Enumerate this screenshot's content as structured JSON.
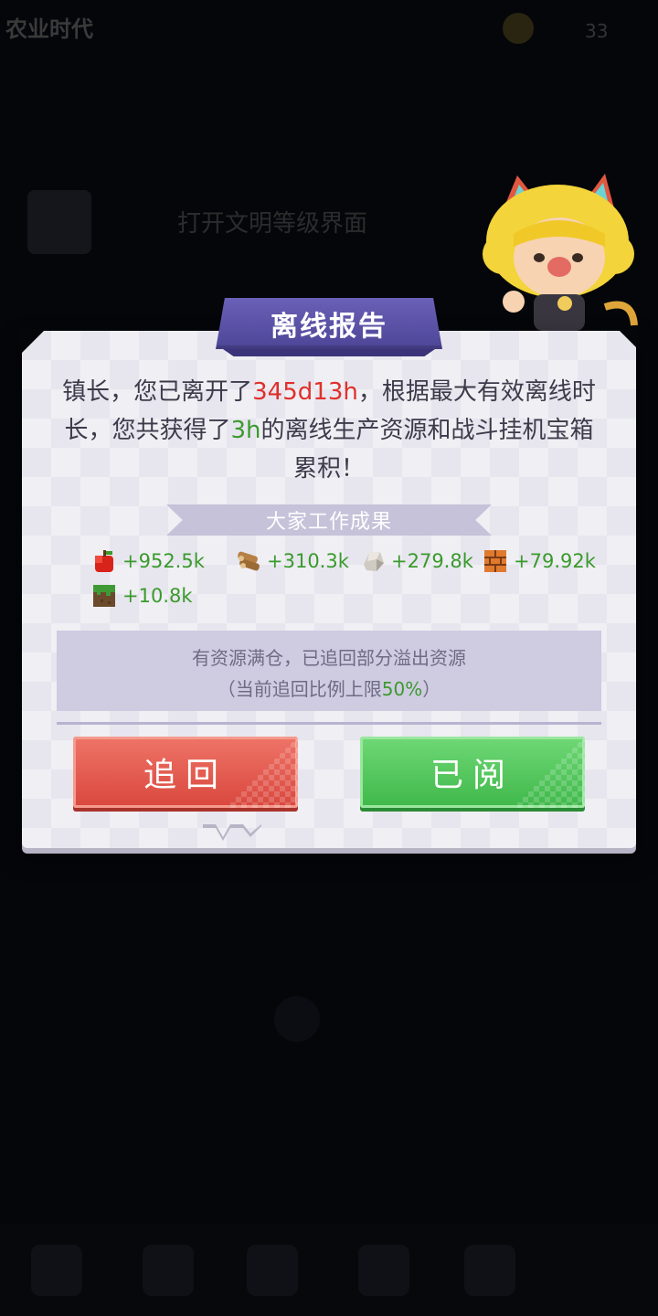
{
  "background": {
    "era_title": "农业时代",
    "coin_value": "33",
    "civ_prompt": "打开文明等级界面"
  },
  "dialog": {
    "title": "离线报告",
    "message": {
      "p1": "镇长，您已离开了",
      "offline_time": "345d13h",
      "p2": "，根据最大有效离线时长，您共获得了",
      "effective_hours": "3h",
      "p3": "的离线生产资源和战斗挂机宝箱累积！"
    },
    "section_title": "大家工作成果",
    "resources": [
      {
        "icon": "apple-icon",
        "value": "+952.5k"
      },
      {
        "icon": "wood-icon",
        "value": "+310.3k"
      },
      {
        "icon": "stone-icon",
        "value": "+279.8k"
      },
      {
        "icon": "brick-icon",
        "value": "+79.92k"
      },
      {
        "icon": "dirt-block-icon",
        "value": "+10.8k"
      }
    ],
    "overflow": {
      "line1": "有资源满仓，已追回部分溢出资源",
      "line2_prefix": "（当前追回比例上限",
      "ratio": "50%",
      "line2_suffix": "）"
    },
    "buttons": {
      "recover": "追回",
      "read": "已阅"
    }
  },
  "colors": {
    "highlight_red": "#e0302a",
    "highlight_green": "#3c9a2f",
    "title_purple": "#5a52a8",
    "button_red": "#e05a4e",
    "button_green": "#4cc657"
  }
}
